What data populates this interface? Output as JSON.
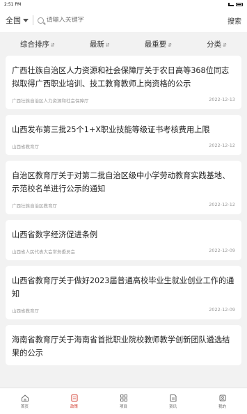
{
  "status": {
    "time": "2:51 PM"
  },
  "header": {
    "region": "全国",
    "search_placeholder": "请输入关键字",
    "search_button": "搜索"
  },
  "sort": {
    "items": [
      {
        "label": "综合排序",
        "arrow": "⇵"
      },
      {
        "label": "最新",
        "arrow": "⇵"
      },
      {
        "label": "最重要",
        "arrow": "⇵"
      },
      {
        "label": "分类",
        "arrow": "⇵"
      }
    ]
  },
  "articles": [
    {
      "title": "广西壮族自治区人力资源和社会保障厅关于农日高等368位同志拟取得广西职业培训、技工教育教师上岗资格的公示",
      "source": "广西壮族自治区人力资源和社会保障厅",
      "date": "2022-12-13"
    },
    {
      "title": "山西发布第三批25个1+X职业技能等级证书考核费用上限",
      "source": "山西省教育厅",
      "date": "2022-12-12"
    },
    {
      "title": "自治区教育厅关于对第二批自治区级中小学劳动教育实践基地、示范校名单进行公示的通知",
      "source": "广西壮族自治区教育厅",
      "date": "2022-12-12"
    },
    {
      "title": "山西省数字经济促进条例",
      "source": "山西省人民代表大会常务委员会",
      "date": "2022-12-09"
    },
    {
      "title": "山西省教育厅关于做好2023届普通高校毕业生就业创业工作的通知",
      "source": "山西省教育厅",
      "date": "2022-12-09"
    },
    {
      "title": "海南省教育厅关于海南省首批职业院校教师教学创新团队遴选结果的公示",
      "source": "",
      "date": ""
    }
  ],
  "tabbar": {
    "items": [
      {
        "label": "首页"
      },
      {
        "label": "政策"
      },
      {
        "label": "项目"
      },
      {
        "label": "资讯"
      },
      {
        "label": "我的"
      }
    ]
  },
  "colors": {
    "accent": "#d23b2e"
  }
}
